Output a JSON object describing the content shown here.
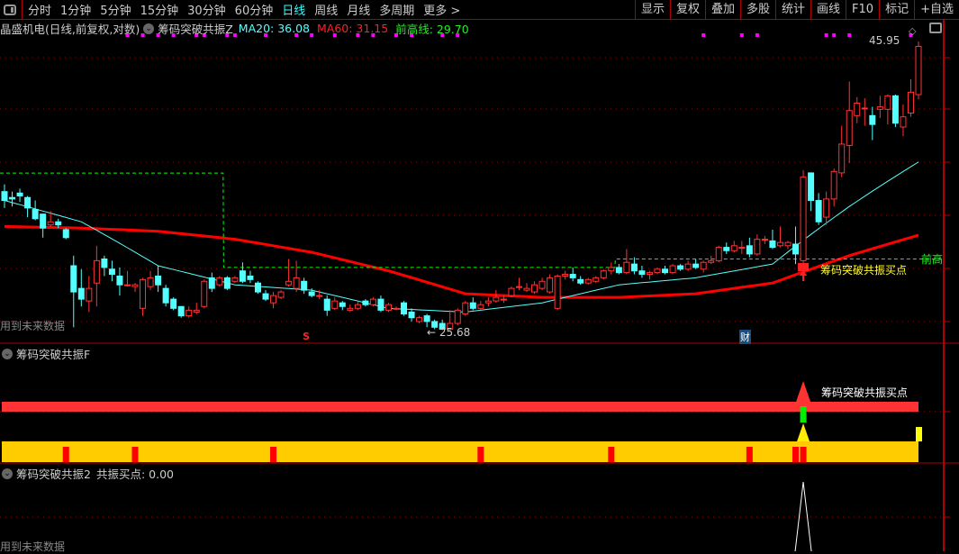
{
  "toolbar": {
    "periods": [
      "分时",
      "1分钟",
      "5分钟",
      "15分钟",
      "30分钟",
      "60分钟",
      "日线",
      "周线",
      "月线",
      "多周期",
      "更多 >"
    ],
    "active_period": "日线",
    "buttons": [
      "显示",
      "复权",
      "叠加",
      "多股",
      "统计",
      "画线",
      "F10",
      "标记",
      "+自选"
    ]
  },
  "main": {
    "stock_title": "晶盛机电(日线,前复权,对数)",
    "indicator_name": "筹码突破共振Z",
    "ma20_label": "MA20: 36.08",
    "ma60_label": "MA60: 31.15",
    "prev_high_label": "前高线: 29.70",
    "prev_high_tag": "前高",
    "max_price_label": "45.95",
    "min_price_label": "25.68",
    "signal_label": "筹码突破共振买点",
    "future_data_note": "用到未来数据",
    "marker_s": "S",
    "marker_cai": "财",
    "colors": {
      "up": "#ff3333",
      "down": "#54ffff",
      "ma20": "#54ffff",
      "ma60": "#ff0000",
      "prev_high": "#00ff00",
      "dots": "#ff00ff"
    },
    "price_scale": "log",
    "candles_ohlc_note": "[open, close, high, low]",
    "candles": [
      [
        34.0,
        33.4,
        34.5,
        32.9
      ],
      [
        33.6,
        33.5,
        34.0,
        33.0
      ],
      [
        33.9,
        33.7,
        34.2,
        33.3
      ],
      [
        33.6,
        32.9,
        33.7,
        32.3
      ],
      [
        32.8,
        32.2,
        33.4,
        32.1
      ],
      [
        32.5,
        31.6,
        32.5,
        31.0
      ],
      [
        31.8,
        32.0,
        32.7,
        31.7
      ],
      [
        32.0,
        31.8,
        32.2,
        31.6
      ],
      [
        31.5,
        31.0,
        31.6,
        30.9
      ],
      [
        29.3,
        27.8,
        29.9,
        25.9
      ],
      [
        28.0,
        27.4,
        29.1,
        27.0
      ],
      [
        27.3,
        28.0,
        28.7,
        26.7
      ],
      [
        28.3,
        29.6,
        30.5,
        27.0
      ],
      [
        29.7,
        29.2,
        29.9,
        28.7
      ],
      [
        29.1,
        28.8,
        29.6,
        28.4
      ],
      [
        28.7,
        28.2,
        29.2,
        27.6
      ],
      [
        28.2,
        28.2,
        29.0,
        28.1
      ],
      [
        28.1,
        28.2,
        28.3,
        27.8
      ],
      [
        26.9,
        28.5,
        28.6,
        26.5
      ],
      [
        28.1,
        28.6,
        29.0,
        27.9
      ],
      [
        28.7,
        28.2,
        29.3,
        27.8
      ],
      [
        28.0,
        27.2,
        28.2,
        27.0
      ],
      [
        27.4,
        26.9,
        27.5,
        26.8
      ],
      [
        27.0,
        26.5,
        27.0,
        26.4
      ],
      [
        26.5,
        26.8,
        27.0,
        26.4
      ],
      [
        26.7,
        26.8,
        27.2,
        26.6
      ],
      [
        27.0,
        28.4,
        28.5,
        26.9
      ],
      [
        28.6,
        28.0,
        28.9,
        27.8
      ],
      [
        28.2,
        28.6,
        28.7,
        28.1
      ],
      [
        28.6,
        28.0,
        28.7,
        27.9
      ],
      [
        28.4,
        28.6,
        28.7,
        28.3
      ],
      [
        29.0,
        28.4,
        29.5,
        28.3
      ],
      [
        28.7,
        28.5,
        29.0,
        28.3
      ],
      [
        28.3,
        27.8,
        28.4,
        27.7
      ],
      [
        27.7,
        27.4,
        27.9,
        27.3
      ],
      [
        27.2,
        27.6,
        27.8,
        26.9
      ],
      [
        27.5,
        27.8,
        27.9,
        27.4
      ],
      [
        28.2,
        28.4,
        29.7,
        28.1
      ],
      [
        28.0,
        28.6,
        29.6,
        27.8
      ],
      [
        28.4,
        27.9,
        28.6,
        27.7
      ],
      [
        27.8,
        27.6,
        28.0,
        27.5
      ],
      [
        27.6,
        27.6,
        27.9,
        27.4
      ],
      [
        27.4,
        26.8,
        27.6,
        26.5
      ],
      [
        26.9,
        27.3,
        27.5,
        26.8
      ],
      [
        27.2,
        27.0,
        27.3,
        26.8
      ],
      [
        26.8,
        26.9,
        27.1,
        26.7
      ],
      [
        26.9,
        27.1,
        27.3,
        26.8
      ],
      [
        27.3,
        27.1,
        27.4,
        27.0
      ],
      [
        27.1,
        27.4,
        27.5,
        27.0
      ],
      [
        27.4,
        26.8,
        27.6,
        26.7
      ],
      [
        26.8,
        27.1,
        27.2,
        26.7
      ],
      [
        26.9,
        26.9,
        27.0,
        26.8
      ],
      [
        27.2,
        26.6,
        27.3,
        26.5
      ],
      [
        26.7,
        26.4,
        26.9,
        26.2
      ],
      [
        26.2,
        26.4,
        26.5,
        26.1
      ],
      [
        26.5,
        26.2,
        26.6,
        25.9
      ],
      [
        26.2,
        25.9,
        26.3,
        25.8
      ],
      [
        26.1,
        25.8,
        26.3,
        25.75
      ],
      [
        25.8,
        26.1,
        26.8,
        25.68
      ],
      [
        26.1,
        26.8,
        26.9,
        26.0
      ],
      [
        26.6,
        27.2,
        27.3,
        26.5
      ],
      [
        27.2,
        26.9,
        27.5,
        26.8
      ],
      [
        26.9,
        27.1,
        27.3,
        26.8
      ],
      [
        27.2,
        27.3,
        27.5,
        27.0
      ],
      [
        27.3,
        27.5,
        27.9,
        27.2
      ],
      [
        27.4,
        27.4,
        27.6,
        27.2
      ],
      [
        27.6,
        28.0,
        28.1,
        27.5
      ],
      [
        28.1,
        28.1,
        28.6,
        27.9
      ],
      [
        27.9,
        28.0,
        28.3,
        27.8
      ],
      [
        27.8,
        28.2,
        28.4,
        27.7
      ],
      [
        28.0,
        28.4,
        28.6,
        27.9
      ],
      [
        27.8,
        28.6,
        28.8,
        27.7
      ],
      [
        26.9,
        28.7,
        28.8,
        26.8
      ],
      [
        28.7,
        28.8,
        29.0,
        28.5
      ],
      [
        28.8,
        28.6,
        29.2,
        28.4
      ],
      [
        28.5,
        28.3,
        28.7,
        28.2
      ],
      [
        28.3,
        28.5,
        28.6,
        28.2
      ],
      [
        28.4,
        28.6,
        28.7,
        28.3
      ],
      [
        28.6,
        29.0,
        29.1,
        28.5
      ],
      [
        29.0,
        29.2,
        29.5,
        28.8
      ],
      [
        29.2,
        28.9,
        29.4,
        28.8
      ],
      [
        28.9,
        29.5,
        30.3,
        28.8
      ],
      [
        29.4,
        29.0,
        29.8,
        28.8
      ],
      [
        29.0,
        28.8,
        29.3,
        28.6
      ],
      [
        28.8,
        28.9,
        29.0,
        28.5
      ],
      [
        28.9,
        29.1,
        29.2,
        28.8
      ],
      [
        29.1,
        28.9,
        29.3,
        28.8
      ],
      [
        28.9,
        29.3,
        29.4,
        28.8
      ],
      [
        29.3,
        29.1,
        29.4,
        29.0
      ],
      [
        29.1,
        29.4,
        29.6,
        29.0
      ],
      [
        29.4,
        29.2,
        29.7,
        29.1
      ],
      [
        29.1,
        29.5,
        29.6,
        28.9
      ],
      [
        29.5,
        29.6,
        29.9,
        29.4
      ],
      [
        29.6,
        30.4,
        30.5,
        29.5
      ],
      [
        30.4,
        30.2,
        30.7,
        30.0
      ],
      [
        30.2,
        30.5,
        30.8,
        30.1
      ],
      [
        30.4,
        30.4,
        30.8,
        30.0
      ],
      [
        30.5,
        30.0,
        31.0,
        29.8
      ],
      [
        30.0,
        30.9,
        31.2,
        29.9
      ],
      [
        30.9,
        30.9,
        31.1,
        30.6
      ],
      [
        30.8,
        30.4,
        31.5,
        30.3
      ],
      [
        30.5,
        30.7,
        31.7,
        30.4
      ],
      [
        30.5,
        30.7,
        30.8,
        30.3
      ],
      [
        30.6,
        30.0,
        31.7,
        29.4
      ],
      [
        29.6,
        35.0,
        35.5,
        29.3
      ],
      [
        35.3,
        33.4,
        35.3,
        32.7
      ],
      [
        33.4,
        32.0,
        33.9,
        31.8
      ],
      [
        32.3,
        33.5,
        34.0,
        31.8
      ],
      [
        33.5,
        35.4,
        35.6,
        33.0
      ],
      [
        35.3,
        37.4,
        38.8,
        35.0
      ],
      [
        37.3,
        40.0,
        42.4,
        36.0
      ],
      [
        39.6,
        40.6,
        41.1,
        39.0
      ],
      [
        40.2,
        40.2,
        41.0,
        38.8
      ],
      [
        39.6,
        38.9,
        40.3,
        37.7
      ],
      [
        40.1,
        40.3,
        41.2,
        39.4
      ],
      [
        40.1,
        41.2,
        41.3,
        38.9
      ],
      [
        41.2,
        39.0,
        41.3,
        38.7
      ],
      [
        38.7,
        39.5,
        40.5,
        38.0
      ],
      [
        39.8,
        41.5,
        42.6,
        39.5
      ],
      [
        41.3,
        45.5,
        45.95,
        40.9
      ]
    ],
    "ma20_samples": {
      "index": [
        0,
        10,
        20,
        30,
        40,
        50,
        60,
        70,
        80,
        90,
        100,
        110,
        119
      ],
      "value": [
        33.4,
        32.0,
        29.3,
        28.2,
        27.9,
        26.9,
        26.7,
        27.2,
        28.2,
        28.6,
        29.4,
        33.0,
        36.08
      ]
    },
    "ma60_samples": {
      "index": [
        0,
        10,
        20,
        30,
        40,
        50,
        60,
        70,
        80,
        90,
        100,
        110,
        119
      ],
      "value": [
        31.7,
        31.6,
        31.4,
        30.9,
        30.1,
        29.0,
        27.7,
        27.5,
        27.5,
        27.7,
        28.3,
        29.9,
        31.15
      ]
    },
    "prev_high_steps": [
      {
        "from": 0,
        "to": 28,
        "value": 35.29
      },
      {
        "from": 29,
        "to": 79,
        "value": 29.2
      },
      {
        "from": 80,
        "to": 119,
        "value": 29.7
      }
    ],
    "dot_indices": [
      16,
      18,
      20,
      22,
      25,
      26,
      29,
      30,
      34,
      38,
      40,
      43,
      46,
      48,
      51,
      53,
      57,
      59,
      91,
      96,
      98,
      107,
      108,
      110,
      118
    ],
    "signal_index": 104,
    "s_marker_index": 39,
    "cai_marker_index": 96
  },
  "panel2": {
    "title": "筹码突破共振F",
    "signal_label": "筹码突破共振买点",
    "red_mark_indices": [
      8,
      17,
      35,
      62,
      79,
      97,
      103,
      104
    ],
    "signal_index": 104
  },
  "panel3": {
    "title": "筹码突破共振2",
    "value_label": "共振买点: 0.00",
    "future_data_note": "用到未来数据",
    "spike_index": 104
  }
}
